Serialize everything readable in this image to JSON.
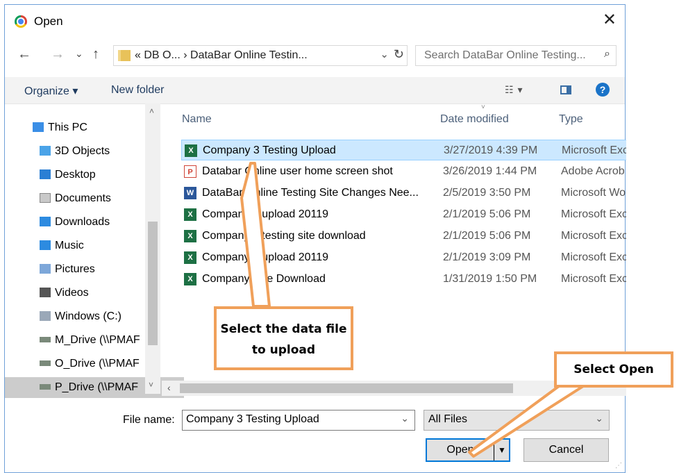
{
  "window": {
    "title": "Open",
    "close_icon": "close-icon"
  },
  "address_bar": {
    "path_text": "«  DB O...  ›  DataBar Online Testin...",
    "search_placeholder": "Search DataBar Online Testing...",
    "back": "←",
    "forward": "→",
    "recent": "⌄",
    "up": "↑",
    "dropdown": "⌄",
    "refresh": "↻",
    "search_glyph": "⌕"
  },
  "toolbar": {
    "organize_label": "Organize ▾",
    "new_folder_label": "New folder",
    "view_glyph": "☷  ▾",
    "help_glyph": "?"
  },
  "sidebar": {
    "items": [
      {
        "label": "This PC",
        "icon": "computer-icon",
        "color": "#3a8ee6"
      },
      {
        "label": "3D Objects",
        "icon": "cube-icon",
        "color": "#4aa3e8"
      },
      {
        "label": "Desktop",
        "icon": "desktop-icon",
        "color": "#2b7fd4"
      },
      {
        "label": "Documents",
        "icon": "documents-icon",
        "color": "#c9c9c9"
      },
      {
        "label": "Downloads",
        "icon": "downloads-icon",
        "color": "#2d8be0"
      },
      {
        "label": "Music",
        "icon": "music-icon",
        "color": "#2d8be0"
      },
      {
        "label": "Pictures",
        "icon": "pictures-icon",
        "color": "#7da7d9"
      },
      {
        "label": "Videos",
        "icon": "videos-icon",
        "color": "#555555"
      },
      {
        "label": "Windows (C:)",
        "icon": "drive-icon",
        "color": "#9aa8b8"
      },
      {
        "label": "M_Drive (\\\\PMAF",
        "icon": "network-drive-icon",
        "color": "#7a8a7a"
      },
      {
        "label": "O_Drive (\\\\PMAF",
        "icon": "network-drive-icon",
        "color": "#7a8a7a"
      },
      {
        "label": "P_Drive (\\\\PMAF",
        "icon": "network-drive-icon",
        "color": "#7a8a7a",
        "selected": true
      }
    ],
    "scroll_up": "˄",
    "scroll_down": "˅"
  },
  "file_list": {
    "columns": {
      "name": "Name",
      "date": "Date modified",
      "type": "Type"
    },
    "sort_chevron": "˅",
    "rows": [
      {
        "name": "Company 3 Testing Upload",
        "date": "3/27/2019 4:39 PM",
        "type": "Microsoft Exc",
        "icon": "excel-icon",
        "selected": true
      },
      {
        "name": "Databar Online user home screen shot",
        "date": "3/26/2019 1:44 PM",
        "type": "Adobe Acrob",
        "icon": "pdf-icon"
      },
      {
        "name": "DataBar Online Testing Site Changes Nee...",
        "date": "2/5/2019 3:50 PM",
        "type": "Microsoft Wo",
        "icon": "word-icon"
      },
      {
        "name": "Company 3 upload 20119",
        "date": "2/1/2019 5:06 PM",
        "type": "Microsoft Exc",
        "icon": "excel-icon"
      },
      {
        "name": "Company 3 testing site download",
        "date": "2/1/2019 5:06 PM",
        "type": "Microsoft Exc",
        "icon": "excel-icon"
      },
      {
        "name": "Company 2 upload 20119",
        "date": "2/1/2019 3:09 PM",
        "type": "Microsoft Exc",
        "icon": "excel-icon"
      },
      {
        "name": "Company Live Download",
        "date": "1/31/2019 1:50 PM",
        "type": "Microsoft Exc",
        "icon": "excel-icon"
      }
    ],
    "scroll_left": "‹"
  },
  "footer": {
    "file_name_label": "File name:",
    "file_name_value": "Company 3 Testing Upload",
    "filter_value": "All Files",
    "dropdown_glyph": "⌄",
    "open_label": "Open",
    "open_split_glyph": "▼",
    "cancel_label": "Cancel"
  },
  "callouts": {
    "select_file": "Select the data file to upload",
    "select_open": "Select Open",
    "color": "#f0a05a"
  },
  "colors": {
    "selection": "#cce8ff",
    "accent": "#0078d7"
  }
}
